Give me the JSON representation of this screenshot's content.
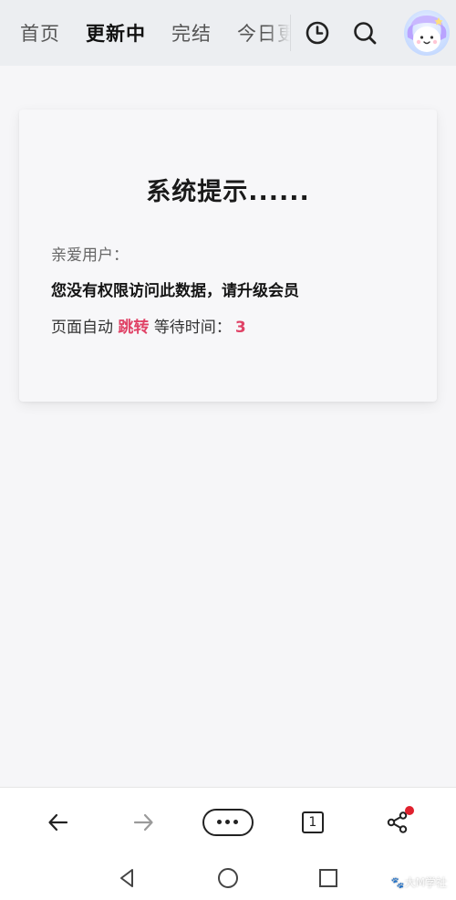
{
  "nav": {
    "tabs": [
      {
        "label": "首页",
        "active": false
      },
      {
        "label": "更新中",
        "active": true
      },
      {
        "label": "完结",
        "active": false
      },
      {
        "label": "今日更新",
        "active": false
      }
    ],
    "icons": [
      "clock-icon",
      "search-icon"
    ],
    "avatar": "avatar"
  },
  "dialog": {
    "title": "系统提示......",
    "greeting": "亲爱用户：",
    "message": "您没有权限访问此数据，请升级会员",
    "redirect_prefix": "页面自动",
    "redirect_link": "跳转",
    "redirect_suffix": "等待时间：",
    "countdown": "3"
  },
  "toolbar": {
    "back": "back-arrow-icon",
    "forward": "forward-arrow-icon",
    "more": "more-icon",
    "tab_count": "1",
    "share": "share-icon"
  },
  "system_nav": [
    "back-triangle-icon",
    "home-circle-icon",
    "recents-square-icon"
  ],
  "watermark": "大M学社",
  "colors": {
    "accent": "#e04266",
    "tab_highlight": "#ffd98a",
    "notification": "#e0212e"
  }
}
